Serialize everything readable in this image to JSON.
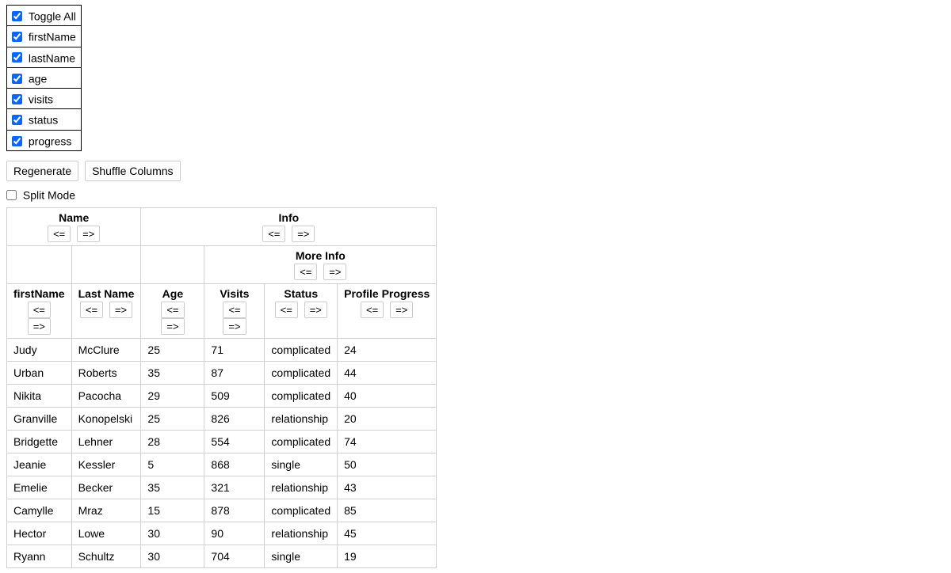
{
  "visibility": {
    "toggleAll": {
      "label": "Toggle All",
      "checked": true
    },
    "items": [
      {
        "key": "firstName",
        "label": "firstName",
        "checked": true
      },
      {
        "key": "lastName",
        "label": "lastName",
        "checked": true
      },
      {
        "key": "age",
        "label": "age",
        "checked": true
      },
      {
        "key": "visits",
        "label": "visits",
        "checked": true
      },
      {
        "key": "status",
        "label": "status",
        "checked": true
      },
      {
        "key": "progress",
        "label": "progress",
        "checked": true
      }
    ]
  },
  "buttons": {
    "regenerate": "Regenerate",
    "shuffle": "Shuffle Columns"
  },
  "splitMode": {
    "label": "Split Mode",
    "checked": false
  },
  "move": {
    "left": "<=",
    "right": "=>"
  },
  "groups": {
    "name": "Name",
    "info": "Info",
    "moreInfo": "More Info"
  },
  "columns": {
    "firstName": "firstName",
    "lastName": "Last Name",
    "age": "Age",
    "visits": "Visits",
    "status": "Status",
    "progress": "Profile Progress"
  },
  "rows": [
    {
      "firstName": "Judy",
      "lastName": "McClure",
      "age": "25",
      "visits": "71",
      "status": "complicated",
      "progress": "24"
    },
    {
      "firstName": "Urban",
      "lastName": "Roberts",
      "age": "35",
      "visits": "87",
      "status": "complicated",
      "progress": "44"
    },
    {
      "firstName": "Nikita",
      "lastName": "Pacocha",
      "age": "29",
      "visits": "509",
      "status": "complicated",
      "progress": "40"
    },
    {
      "firstName": "Granville",
      "lastName": "Konopelski",
      "age": "25",
      "visits": "826",
      "status": "relationship",
      "progress": "20"
    },
    {
      "firstName": "Bridgette",
      "lastName": "Lehner",
      "age": "28",
      "visits": "554",
      "status": "complicated",
      "progress": "74"
    },
    {
      "firstName": "Jeanie",
      "lastName": "Kessler",
      "age": "5",
      "visits": "868",
      "status": "single",
      "progress": "50"
    },
    {
      "firstName": "Emelie",
      "lastName": "Becker",
      "age": "35",
      "visits": "321",
      "status": "relationship",
      "progress": "43"
    },
    {
      "firstName": "Camylle",
      "lastName": "Mraz",
      "age": "15",
      "visits": "878",
      "status": "complicated",
      "progress": "85"
    },
    {
      "firstName": "Hector",
      "lastName": "Lowe",
      "age": "30",
      "visits": "90",
      "status": "relationship",
      "progress": "45"
    },
    {
      "firstName": "Ryann",
      "lastName": "Schultz",
      "age": "30",
      "visits": "704",
      "status": "single",
      "progress": "19"
    }
  ]
}
